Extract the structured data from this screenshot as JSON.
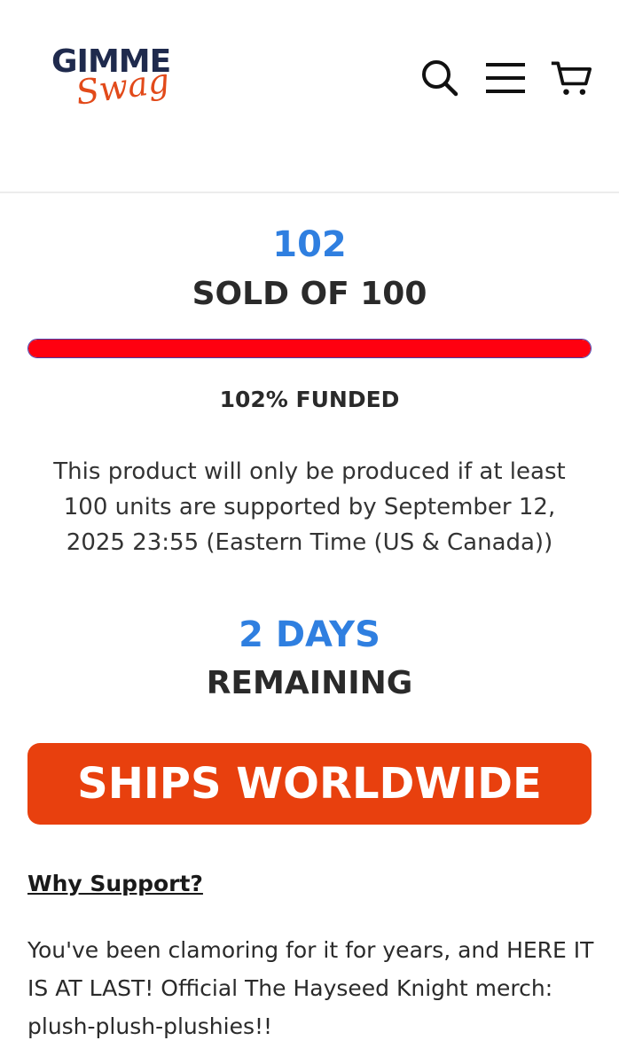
{
  "brand": {
    "logo_top": "GIMME",
    "logo_bottom": "Swag",
    "colors": {
      "navy": "#1f2a4d",
      "orange": "#e24a1a"
    }
  },
  "header": {
    "icons": [
      "search-icon",
      "menu-icon",
      "cart-icon"
    ]
  },
  "campaign": {
    "sold_count": "102",
    "sold_label": "SOLD OF 100",
    "progress_fraction": 1.0,
    "funded_label": "102% FUNDED",
    "notice": "This product will only be produced if at least 100 units are supported by September 12, 2025 23:55 (Eastern Time (US & Canada))",
    "days_count": "2 DAYS",
    "days_label": "REMAINING",
    "accent_color": "#2f7fe0",
    "progress_color": "#ff0010"
  },
  "banner": {
    "text": "SHIPS WORLDWIDE",
    "color": "#e8400e"
  },
  "description": {
    "link_label": "Why Support?",
    "body": "You've been clamoring for it for years, and HERE IT IS AT LAST! Official The Hayseed Knight merch: plush-plush-plushies!!"
  }
}
